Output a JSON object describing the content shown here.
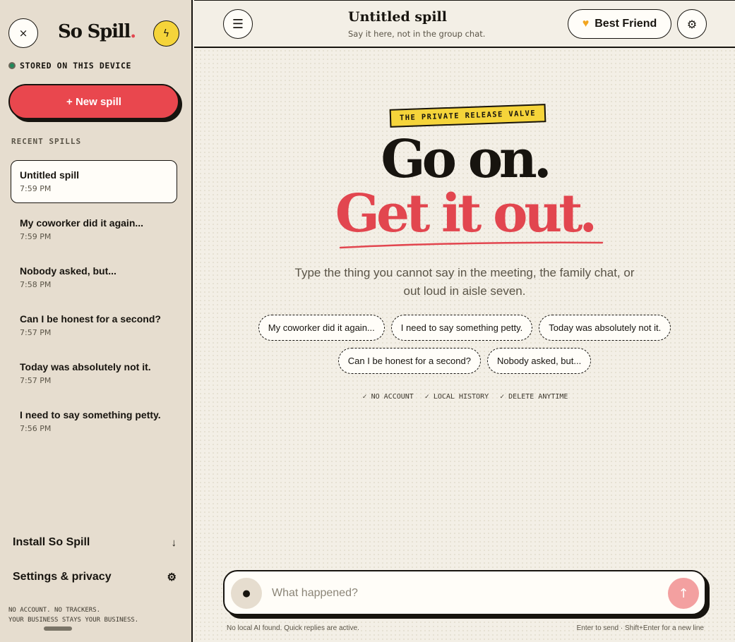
{
  "sidebar": {
    "close_icon": "×",
    "brand": "So Spill",
    "brand_dot": ".",
    "bolt_icon": "ϟ",
    "stored_label": "STORED ON THIS DEVICE",
    "new_spill_label": "+  New spill",
    "recent_title": "RECENT SPILLS",
    "recent": [
      {
        "title": "Untitled spill",
        "time": "7:59 PM"
      },
      {
        "title": "My coworker did it again...",
        "time": "7:59 PM"
      },
      {
        "title": "Nobody asked, but...",
        "time": "7:58 PM"
      },
      {
        "title": "Can I be honest for a second?",
        "time": "7:57 PM"
      },
      {
        "title": "Today was absolutely not it.",
        "time": "7:57 PM"
      },
      {
        "title": "I need to say something petty.",
        "time": "7:56 PM"
      }
    ],
    "install_label": "Install So Spill",
    "install_icon": "↓",
    "settings_label": "Settings & privacy",
    "settings_icon": "⚙",
    "footnote_line1": "NO ACCOUNT. NO TRACKERS.",
    "footnote_line2": "YOUR BUSINESS STAYS YOUR BUSINESS."
  },
  "header": {
    "menu_icon": "☰",
    "title": "Untitled spill",
    "subtitle": "Say it here, not in the group chat.",
    "persona_icon": "♥",
    "persona_label": "Best Friend",
    "gear_icon": "⚙"
  },
  "main": {
    "tag": "THE PRIVATE RELEASE VALVE",
    "hero_line1": "Go on.",
    "hero_line2": "Get it out.",
    "lede": "Type the thing you cannot say in the meeting, the family chat, or out loud in aisle seven.",
    "chips": [
      "My coworker did it again...",
      "I need to say something petty.",
      "Today was absolutely not it.",
      "Can I be honest for a second?",
      "Nobody asked, but..."
    ],
    "badges": [
      "✓ NO ACCOUNT",
      "✓ LOCAL HISTORY",
      "✓ DELETE ANYTIME"
    ]
  },
  "composer": {
    "mic_icon": "●",
    "placeholder": "What happened?",
    "send_icon": "↑",
    "hint_left": "No local AI found. Quick replies are active.",
    "hint_right": "Enter to send · Shift+Enter for a new line"
  },
  "colors": {
    "accent_red": "#e2464f",
    "accent_yellow": "#f5d43a",
    "ink": "#17140f",
    "status_green": "#1f8a5b"
  }
}
